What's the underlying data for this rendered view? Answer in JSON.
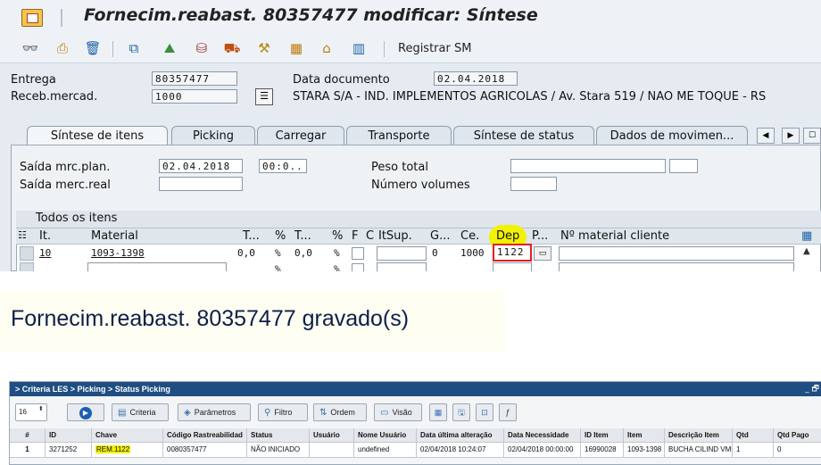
{
  "sap": {
    "title": "Fornecim.reabast. 80357477 modificar: Síntese",
    "toolbar": {
      "registrar_label": "Registrar SM"
    },
    "header": {
      "entrega_label": "Entrega",
      "entrega_value": "80357477",
      "receb_label": "Receb.mercad.",
      "receb_value": "1000",
      "data_doc_label": "Data documento",
      "data_doc_value": "02.04.2018",
      "partner_text": "STARA S/A - IND. IMPLEMENTOS AGRICOLAS / Av. Stara 519 / NAO ME TOQUE - RS"
    },
    "tabs": [
      {
        "label": "Síntese de itens"
      },
      {
        "label": "Picking"
      },
      {
        "label": "Carregar"
      },
      {
        "label": "Transporte"
      },
      {
        "label": "Síntese de status"
      },
      {
        "label": "Dados de movimen..."
      }
    ],
    "form": {
      "saida_plan_label": "Saída mrc.plan.",
      "saida_plan_date": "02.04.2018",
      "saida_plan_time": "00:0..",
      "saida_real_label": "Saída merc.real",
      "peso_label": "Peso total",
      "volumes_label": "Número volumes"
    },
    "grid": {
      "title": "Todos os itens",
      "headers": [
        "It.",
        "Material",
        "T...",
        "%",
        "T...",
        "%",
        "F",
        "C",
        "ItSup.",
        "G...",
        "Ce.",
        "Dep",
        "P...",
        "Nº material cliente"
      ],
      "row": {
        "it": "10",
        "material": "1093-1398",
        "t1": "0,0",
        "p1": "%",
        "t2": "0,0",
        "p2": "%",
        "g": "0",
        "ce": "1000",
        "dep": "1122"
      },
      "row2": {
        "p1": "%",
        "p2": "%"
      }
    }
  },
  "message": {
    "text": "Fornecim.reabast. 80357477 gravado(s)"
  },
  "les": {
    "breadcrumb": "> Criteria LES > Picking > Status Picking",
    "window_controls": "_ 🗗",
    "page_size": "16",
    "buttons": {
      "criteria": "Criteria",
      "parametros": "Parâmetros",
      "filtro": "Filtro",
      "ordem": "Ordem",
      "visao": "Visão"
    },
    "columns": [
      "#",
      "ID",
      "Chave",
      "Código Rastreabilidad",
      "Status",
      "Usuário",
      "Nome Usuário",
      "Data última alteração",
      "Data Necessidade",
      "ID Item",
      "Item",
      "Descrição Item",
      "Qtd",
      "Qtd Pago"
    ],
    "row": [
      "1",
      "3271252",
      "REM.1122",
      "0080357477",
      "NÃO INICIADO",
      "",
      "undefined",
      "02/04/2018 10:24:07",
      "02/04/2018 00:00:00",
      "16990028",
      "1093-1398",
      "BUCHA CILIND VME",
      "1",
      "0"
    ]
  },
  "colors": {
    "highlight": "#f2f200",
    "les_title_bg": "#1f4e82",
    "message_text": "#0d1e4a"
  }
}
